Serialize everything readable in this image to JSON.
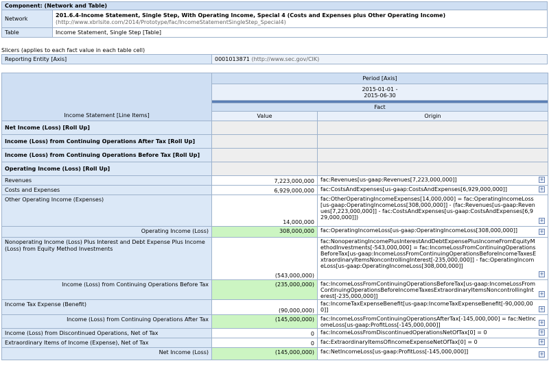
{
  "component": {
    "title": "Component: (Network and Table)",
    "network_label": "Network",
    "network_value": "201.6.4-Income Statement, Single Step, With Operating Income, Special 4 (Costs and Expenses plus Other Operating Income)",
    "network_url": "(http://www.xbrlsite.com/2014/Prototype/fac/IncomeStatementSingleStep_Special4)",
    "table_label": "Table",
    "table_value": "Income Statement, Single Step [Table]"
  },
  "slicers": {
    "caption": "Slicers (applies to each fact value in each table cell)",
    "entity_label": "Reporting Entity [Axis]",
    "entity_value": "0001013871",
    "entity_url": "(http://www.sec.gov/CIK)"
  },
  "table": {
    "line_items_header": "Income Statement [Line Items]",
    "period_axis": "Period [Axis]",
    "period_value": "2015-01-01 -\n2015-06-30",
    "fact_header": "Fact",
    "value_header": "Value",
    "origin_header": "Origin",
    "rows": [
      {
        "label": "Net Income (Loss) [Roll Up]",
        "value": "",
        "origin": ""
      },
      {
        "label": "Income (Loss) from Continuing Operations After Tax [Roll Up]",
        "value": "",
        "origin": ""
      },
      {
        "label": "Income (Loss) from Continuing Operations Before Tax [Roll Up]",
        "value": "",
        "origin": ""
      },
      {
        "label": "Operating Income (Loss) [Roll Up]",
        "value": "",
        "origin": ""
      },
      {
        "label": "Revenues",
        "value": "7,223,000,000",
        "origin": "fac:Revenues[us-gaap:Revenues[7,223,000,000]]"
      },
      {
        "label": "Costs and Expenses",
        "value": "6,929,000,000",
        "origin": "fac:CostsAndExpenses[us-gaap:CostsAndExpenses[6,929,000,000]]"
      },
      {
        "label": "Other Operating Income (Expenses)",
        "value": "14,000,000",
        "origin": "fac:OtherOperatingIncomeExpenses[14,000,000] = fac:OperatingIncomeLoss[us-gaap:OperatingIncomeLoss[308,000,000]] - (fac:Revenues[us-gaap:Revenues[7,223,000,000]] - fac:CostsAndExpenses[us-gaap:CostsAndExpenses[6,929,000,000]])"
      },
      {
        "label": "Operating Income (Loss)",
        "value": "308,000,000",
        "origin": "fac:OperatingIncomeLoss[us-gaap:OperatingIncomeLoss[308,000,000]]"
      },
      {
        "label": "Nonoperating Income (Loss) Plus Interest and Debt Expense Plus Income (Loss) from Equity Method Investments",
        "value": "(543,000,000)",
        "origin": "fac:NonoperatingIncomePlusInterestAndDebtExpensePlusIncomeFromEquityMethodInvestments[-543,000,000] = fac:IncomeLossFromContinuingOperationsBeforeTax[us-gaap:IncomeLossFromContinuingOperationsBeforeIncomeTaxesExtraordinaryItemsNoncontrollingInterest[-235,000,000]] - fac:OperatingIncomeLoss[us-gaap:OperatingIncomeLoss[308,000,000]]"
      },
      {
        "label": "Income (Loss) from Continuing Operations Before Tax",
        "value": "(235,000,000)",
        "origin": "fac:IncomeLossFromContinuingOperationsBeforeTax[us-gaap:IncomeLossFromContinuingOperationsBeforeIncomeTaxesExtraordinaryItemsNoncontrollingInterest[-235,000,000]]"
      },
      {
        "label": "Income Tax Expense (Benefit)",
        "value": "(90,000,000)",
        "origin": "fac:IncomeTaxExpenseBenefit[us-gaap:IncomeTaxExpenseBenefit[-90,000,000]]"
      },
      {
        "label": "Income (Loss) from Continuing Operations After Tax",
        "value": "(145,000,000)",
        "origin": "fac:IncomeLossFromContinuingOperationsAfterTax[-145,000,000] = fac:NetIncomeLoss[us-gaap:ProfitLoss[-145,000,000]]"
      },
      {
        "label": "Income (Loss) from Discontinued Operations, Net of Tax",
        "value": "0",
        "origin": "fac:IncomeLossFromDiscontinuedOperationsNetOfTax[0] = 0"
      },
      {
        "label": "Extraordinary Items of Income (Expense), Net of Tax",
        "value": "0",
        "origin": "fac:ExtraordinaryItemsOfIncomeExpenseNetOfTax[0] = 0"
      },
      {
        "label": "Net Income (Loss)",
        "value": "(145,000,000)",
        "origin": "fac:NetIncomeLoss[us-gaap:ProfitLoss[-145,000,000]]"
      }
    ],
    "expand_glyph": "+",
    "colors": {
      "header_bg": "#cfdff3",
      "label_bg": "#dbe8f7",
      "total_bg": "#ccf5c2",
      "fact_bg": "#5a7fb5",
      "border": "#9db2cc"
    }
  }
}
